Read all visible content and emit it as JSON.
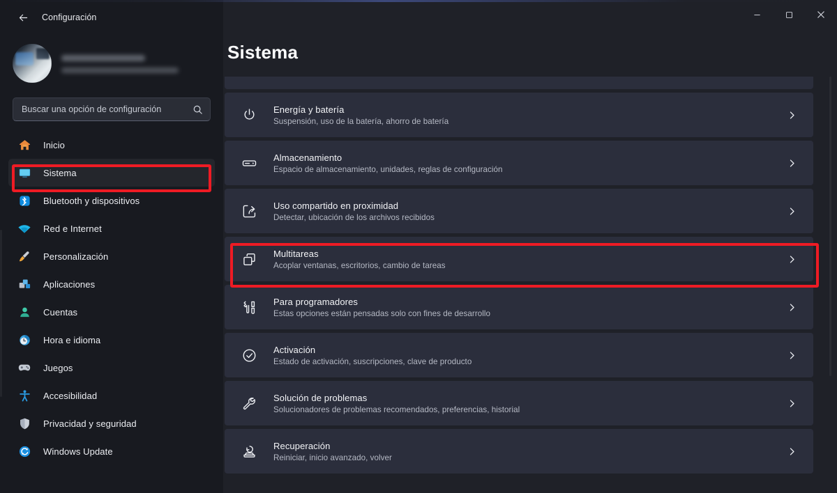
{
  "window": {
    "app_title": "Configuración",
    "back_icon": "back-arrow-icon",
    "controls": {
      "minimize": "minimize-icon",
      "maximize": "maximize-icon",
      "close": "close-icon"
    }
  },
  "sidebar": {
    "account": {
      "avatar": "user-avatar",
      "name_redacted": "",
      "email_redacted": ""
    },
    "search": {
      "placeholder": "Buscar una opción de configuración",
      "value": "",
      "icon": "search-icon"
    },
    "items": [
      {
        "label": "Inicio",
        "icon": "home-icon",
        "selected": false
      },
      {
        "label": "Sistema",
        "icon": "system-icon",
        "selected": true
      },
      {
        "label": "Bluetooth y dispositivos",
        "icon": "bluetooth-icon",
        "selected": false
      },
      {
        "label": "Red e Internet",
        "icon": "wifi-icon",
        "selected": false
      },
      {
        "label": "Personalización",
        "icon": "brush-icon",
        "selected": false
      },
      {
        "label": "Aplicaciones",
        "icon": "apps-icon",
        "selected": false
      },
      {
        "label": "Cuentas",
        "icon": "account-icon",
        "selected": false
      },
      {
        "label": "Hora e idioma",
        "icon": "clock-icon",
        "selected": false
      },
      {
        "label": "Juegos",
        "icon": "gamepad-icon",
        "selected": false
      },
      {
        "label": "Accesibilidad",
        "icon": "accessibility-icon",
        "selected": false
      },
      {
        "label": "Privacidad y seguridad",
        "icon": "shield-icon",
        "selected": false
      },
      {
        "label": "Windows Update",
        "icon": "update-icon",
        "selected": false
      }
    ]
  },
  "main": {
    "title": "Sistema",
    "chevron_icon": "chevron-right-icon",
    "rows": [
      {
        "title": "Energía y batería",
        "subtitle": "Suspensión, uso de la batería, ahorro de batería",
        "icon": "power-icon",
        "highlighted": false
      },
      {
        "title": "Almacenamiento",
        "subtitle": "Espacio de almacenamiento, unidades, reglas de configuración",
        "icon": "storage-icon",
        "highlighted": false
      },
      {
        "title": "Uso compartido en proximidad",
        "subtitle": "Detectar, ubicación de los archivos recibidos",
        "icon": "nearby-share-icon",
        "highlighted": false
      },
      {
        "title": "Multitareas",
        "subtitle": "Acoplar ventanas, escritorios, cambio de tareas",
        "icon": "multitasking-icon",
        "highlighted": true
      },
      {
        "title": "Para programadores",
        "subtitle": "Estas opciones están pensadas solo con fines de desarrollo",
        "icon": "developer-tools-icon",
        "highlighted": false
      },
      {
        "title": "Activación",
        "subtitle": "Estado de activación, suscripciones, clave de producto",
        "icon": "check-circle-icon",
        "highlighted": false
      },
      {
        "title": "Solución de problemas",
        "subtitle": "Solucionadores de problemas recomendados, preferencias, historial",
        "icon": "wrench-icon",
        "highlighted": false
      },
      {
        "title": "Recuperación",
        "subtitle": "Reiniciar, inicio avanzado, volver",
        "icon": "recovery-icon",
        "highlighted": false
      }
    ]
  },
  "annotations": {
    "highlight_color": "#ee1b24",
    "boxes": [
      "sidebar-item-sistema",
      "row-multitareas"
    ]
  },
  "theme": {
    "window_bg": "#1f2128",
    "sidebar_bg": "#181a20",
    "card_bg": "#2b2e3c",
    "accent": "#4cc2ff",
    "text_primary": "#f3f4f7",
    "text_secondary": "#b6bac5"
  }
}
